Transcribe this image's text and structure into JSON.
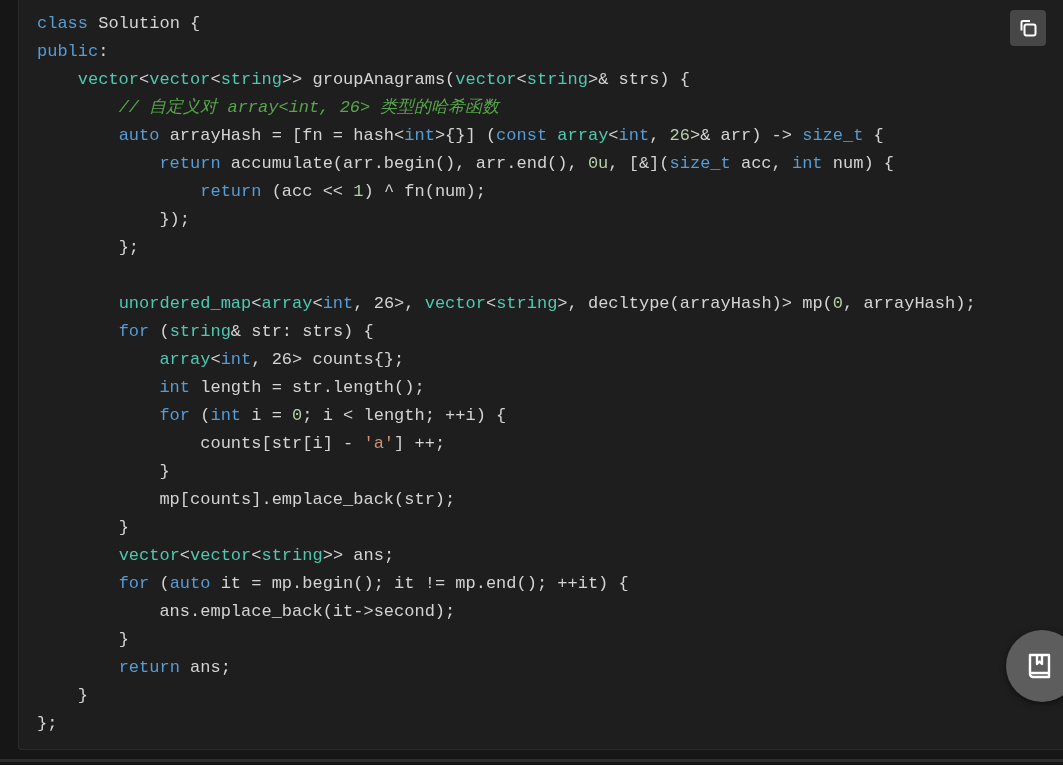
{
  "code_block": {
    "lines": [
      {
        "kind": "code",
        "tokens": [
          {
            "kind": "keyword",
            "text": "class"
          },
          {
            "kind": "plain",
            "text": " Solution {"
          }
        ]
      },
      {
        "kind": "code",
        "tokens": [
          {
            "kind": "keyword",
            "text": "public"
          },
          {
            "kind": "plain",
            "text": ":"
          }
        ]
      },
      {
        "kind": "code",
        "tokens": [
          {
            "kind": "type",
            "text": "    vector"
          },
          {
            "kind": "plain",
            "text": "<"
          },
          {
            "kind": "type",
            "text": "vector"
          },
          {
            "kind": "plain",
            "text": "<"
          },
          {
            "kind": "type",
            "text": "string"
          },
          {
            "kind": "plain",
            "text": ">> groupAnagrams("
          },
          {
            "kind": "type",
            "text": "vector"
          },
          {
            "kind": "plain",
            "text": "<"
          },
          {
            "kind": "type",
            "text": "string"
          },
          {
            "kind": "plain",
            "text": ">& strs) {"
          }
        ]
      },
      {
        "kind": "code",
        "tokens": [
          {
            "kind": "comment",
            "text": "        // 自定义对 array<int, 26> 类型的哈希函数"
          }
        ]
      },
      {
        "kind": "code",
        "tokens": [
          {
            "kind": "keyword",
            "text": "        auto"
          },
          {
            "kind": "plain",
            "text": " arrayHash = [fn = hash<"
          },
          {
            "kind": "keyword",
            "text": "int"
          },
          {
            "kind": "plain",
            "text": ">{}] ("
          },
          {
            "kind": "keyword",
            "text": "const "
          },
          {
            "kind": "type",
            "text": "array"
          },
          {
            "kind": "plain",
            "text": "<"
          },
          {
            "kind": "keyword",
            "text": "int"
          },
          {
            "kind": "plain",
            "text": ", "
          },
          {
            "kind": "number",
            "text": "26"
          },
          {
            "kind": "plain",
            "text": ">& arr) -> "
          },
          {
            "kind": "keyword",
            "text": "size_t"
          },
          {
            "kind": "plain",
            "text": " {"
          }
        ]
      },
      {
        "kind": "code",
        "tokens": [
          {
            "kind": "keyword",
            "text": "            return"
          },
          {
            "kind": "plain",
            "text": " accumulate(arr.begin(), arr.end(), "
          },
          {
            "kind": "number",
            "text": "0u"
          },
          {
            "kind": "plain",
            "text": ", [&]("
          },
          {
            "kind": "keyword",
            "text": "size_t"
          },
          {
            "kind": "plain",
            "text": " acc, "
          },
          {
            "kind": "keyword",
            "text": "int"
          },
          {
            "kind": "plain",
            "text": " num) {"
          }
        ]
      },
      {
        "kind": "code",
        "tokens": [
          {
            "kind": "keyword",
            "text": "                return"
          },
          {
            "kind": "plain",
            "text": " (acc << "
          },
          {
            "kind": "number",
            "text": "1"
          },
          {
            "kind": "plain",
            "text": ") ^ fn(num);"
          }
        ]
      },
      {
        "kind": "code",
        "tokens": [
          {
            "kind": "plain",
            "text": "            });"
          }
        ]
      },
      {
        "kind": "code",
        "tokens": [
          {
            "kind": "plain",
            "text": "        };"
          }
        ]
      },
      {
        "kind": "blank"
      },
      {
        "kind": "code",
        "tokens": [
          {
            "kind": "type",
            "text": "        unordered_map"
          },
          {
            "kind": "plain",
            "text": "<"
          },
          {
            "kind": "type",
            "text": "array"
          },
          {
            "kind": "plain",
            "text": "<"
          },
          {
            "kind": "keyword",
            "text": "int"
          },
          {
            "kind": "plain",
            "text": ", 26>, "
          },
          {
            "kind": "type",
            "text": "vector"
          },
          {
            "kind": "plain",
            "text": "<"
          },
          {
            "kind": "type",
            "text": "string"
          },
          {
            "kind": "plain",
            "text": ">, decltype(arrayHash)> mp("
          },
          {
            "kind": "number",
            "text": "0"
          },
          {
            "kind": "plain",
            "text": ", arrayHash);"
          }
        ]
      },
      {
        "kind": "code",
        "tokens": [
          {
            "kind": "keyword",
            "text": "        for"
          },
          {
            "kind": "plain",
            "text": " ("
          },
          {
            "kind": "type",
            "text": "string"
          },
          {
            "kind": "plain",
            "text": "& str: strs) {"
          }
        ]
      },
      {
        "kind": "code",
        "tokens": [
          {
            "kind": "type",
            "text": "            array"
          },
          {
            "kind": "plain",
            "text": "<"
          },
          {
            "kind": "keyword",
            "text": "int"
          },
          {
            "kind": "plain",
            "text": ", 26> counts{};"
          }
        ]
      },
      {
        "kind": "code",
        "tokens": [
          {
            "kind": "keyword",
            "text": "            int"
          },
          {
            "kind": "plain",
            "text": " length = str.length();"
          }
        ]
      },
      {
        "kind": "code",
        "tokens": [
          {
            "kind": "keyword",
            "text": "            for"
          },
          {
            "kind": "plain",
            "text": " ("
          },
          {
            "kind": "keyword",
            "text": "int"
          },
          {
            "kind": "plain",
            "text": " i = "
          },
          {
            "kind": "number",
            "text": "0"
          },
          {
            "kind": "plain",
            "text": "; i < length; ++i) {"
          }
        ]
      },
      {
        "kind": "code",
        "tokens": [
          {
            "kind": "plain",
            "text": "                counts[str[i] - "
          },
          {
            "kind": "string",
            "text": "'a'"
          },
          {
            "kind": "plain",
            "text": "] ++;"
          }
        ]
      },
      {
        "kind": "code",
        "tokens": [
          {
            "kind": "plain",
            "text": "            }"
          }
        ]
      },
      {
        "kind": "code",
        "tokens": [
          {
            "kind": "plain",
            "text": "            mp[counts].emplace_back(str);"
          }
        ]
      },
      {
        "kind": "code",
        "tokens": [
          {
            "kind": "plain",
            "text": "        }"
          }
        ]
      },
      {
        "kind": "code",
        "tokens": [
          {
            "kind": "type",
            "text": "        vector"
          },
          {
            "kind": "plain",
            "text": "<"
          },
          {
            "kind": "type",
            "text": "vector"
          },
          {
            "kind": "plain",
            "text": "<"
          },
          {
            "kind": "type",
            "text": "string"
          },
          {
            "kind": "plain",
            "text": ">> ans;"
          }
        ]
      },
      {
        "kind": "code",
        "tokens": [
          {
            "kind": "keyword",
            "text": "        for"
          },
          {
            "kind": "plain",
            "text": " ("
          },
          {
            "kind": "keyword",
            "text": "auto"
          },
          {
            "kind": "plain",
            "text": " it = mp.begin(); it != mp.end(); ++it) {"
          }
        ]
      },
      {
        "kind": "code",
        "tokens": [
          {
            "kind": "plain",
            "text": "            ans.emplace_back(it->second);"
          }
        ]
      },
      {
        "kind": "code",
        "tokens": [
          {
            "kind": "plain",
            "text": "        }"
          }
        ]
      },
      {
        "kind": "code",
        "tokens": [
          {
            "kind": "keyword",
            "text": "        return"
          },
          {
            "kind": "plain",
            "text": " ans;"
          }
        ]
      },
      {
        "kind": "code",
        "tokens": [
          {
            "kind": "plain",
            "text": "    }"
          }
        ]
      },
      {
        "kind": "code",
        "tokens": [
          {
            "kind": "plain",
            "text": "};"
          }
        ]
      }
    ]
  }
}
